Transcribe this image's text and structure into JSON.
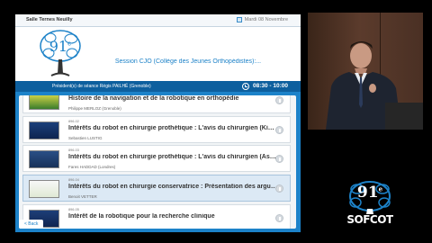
{
  "screen": {
    "room": "Salle Ternes Neuilly",
    "date": "Mardi 08 Novembre",
    "logo_number": "91",
    "logo_sup": "e",
    "session_title": "Session CJO (Collège des Jeunes Orthopédistes):...",
    "president": "Président(s) de séance Régis  PAILHÉ (Grenoble)",
    "time": "08:30 - 10:00",
    "back_label": "< Back",
    "talks": [
      {
        "code": "",
        "title": "Histoire de la navigation et de la robotique en orthopédie",
        "speaker": "Philippe MERLOZ (Grenoble)",
        "selected": false
      },
      {
        "code": "896-02",
        "title": "Intérêts du robot en chirurgie prothétique : L'avis du chirurgien (Kinésithérapeute)",
        "speaker": "Sebastien LUSTIG",
        "selected": false
      },
      {
        "code": "896-03",
        "title": "Intérêts du robot en chirurgie prothétique : L'avis du chirurgien (Assistant)",
        "speaker": "Fares HADDAD (Londres)",
        "selected": false
      },
      {
        "code": "896-04",
        "title": "Intérêts du robot en chirurgie conservatrice : Présentation des arguments",
        "speaker": "Benoit VETTER",
        "selected": true
      },
      {
        "code": "896-05",
        "title": "Intérêt de la robotique pour la recherche clinique",
        "speaker": "",
        "selected": false
      }
    ]
  },
  "sofcot_logo": {
    "number": "91",
    "sup": "e",
    "text": "SOFCOT"
  },
  "colors": {
    "screen_blue": "#1c82c9",
    "dark_blue": "#0d5f9e",
    "accent": "#1d82c8"
  }
}
